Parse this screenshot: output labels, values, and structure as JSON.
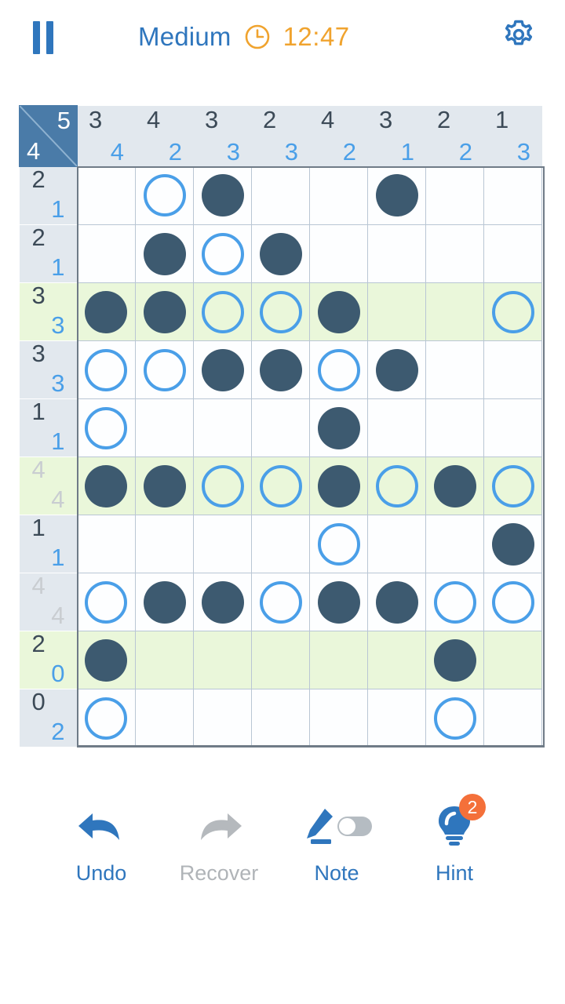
{
  "header": {
    "pause_icon": "pause-icon",
    "difficulty": "Medium",
    "clock_icon": "clock-icon",
    "timer": "12:47",
    "settings_icon": "gear-icon",
    "accent_blue": "#2f76bd",
    "timer_orange": "#f0a32e"
  },
  "board": {
    "corner": {
      "top_right": "5",
      "bottom_left": "4"
    },
    "col_headers": [
      {
        "dark": "3",
        "blue": "4",
        "done": false
      },
      {
        "dark": "4",
        "blue": "2",
        "done": false
      },
      {
        "dark": "3",
        "blue": "3",
        "done": false
      },
      {
        "dark": "2",
        "blue": "3",
        "done": false
      },
      {
        "dark": "4",
        "blue": "2",
        "done": false
      },
      {
        "dark": "3",
        "blue": "1",
        "done": false
      },
      {
        "dark": "2",
        "blue": "2",
        "done": false
      },
      {
        "dark": "1",
        "blue": "3",
        "done": false
      }
    ],
    "row_headers": [
      {
        "dark": "2",
        "blue": "1",
        "done": false,
        "highlight": false
      },
      {
        "dark": "2",
        "blue": "1",
        "done": false,
        "highlight": false
      },
      {
        "dark": "3",
        "blue": "3",
        "done": false,
        "highlight": true
      },
      {
        "dark": "3",
        "blue": "3",
        "done": false,
        "highlight": false
      },
      {
        "dark": "1",
        "blue": "1",
        "done": false,
        "highlight": false
      },
      {
        "dark": "4",
        "blue": "4",
        "done": true,
        "highlight": true
      },
      {
        "dark": "1",
        "blue": "1",
        "done": false,
        "highlight": false
      },
      {
        "dark": "4",
        "blue": "4",
        "done": true,
        "highlight": false
      },
      {
        "dark": "2",
        "blue": "0",
        "done": false,
        "highlight": true
      },
      {
        "dark": "0",
        "blue": "2",
        "done": false,
        "highlight": false
      }
    ],
    "legend": {
      "filled": "filled",
      "empty": "empty",
      "blank": ""
    },
    "cells": [
      [
        "",
        "empty",
        "filled",
        "",
        "",
        "filled",
        "",
        ""
      ],
      [
        "",
        "filled",
        "empty",
        "filled",
        "",
        "",
        "",
        ""
      ],
      [
        "filled",
        "filled",
        "empty",
        "empty",
        "filled",
        "",
        "",
        "empty"
      ],
      [
        "empty",
        "empty",
        "filled",
        "filled",
        "empty",
        "filled",
        "",
        ""
      ],
      [
        "empty",
        "",
        "",
        "",
        "filled",
        "",
        "",
        ""
      ],
      [
        "filled",
        "filled",
        "empty",
        "empty",
        "filled",
        "empty",
        "filled",
        "empty"
      ],
      [
        "",
        "",
        "",
        "",
        "empty",
        "",
        "",
        "filled"
      ],
      [
        "empty",
        "filled",
        "filled",
        "empty",
        "filled",
        "filled",
        "empty",
        "empty"
      ],
      [
        "filled",
        "",
        "",
        "",
        "",
        "",
        "filled",
        ""
      ],
      [
        "empty",
        "",
        "",
        "",
        "",
        "",
        "empty",
        ""
      ]
    ],
    "colors": {
      "filled_dot": "#3d5a70",
      "empty_ring": "#4a9fe8",
      "header_bg": "#e2e8ee",
      "highlight_bg": "#eaf7da",
      "corner_bg": "#4a7ba8",
      "grid_line": "#b9c6d4"
    }
  },
  "toolbar": {
    "undo": {
      "label": "Undo",
      "icon": "undo-arrow-icon",
      "enabled": true
    },
    "recover": {
      "label": "Recover",
      "icon": "redo-arrow-icon",
      "enabled": false
    },
    "note": {
      "label": "Note",
      "icon": "pencil-icon",
      "toggle_on": false
    },
    "hint": {
      "label": "Hint",
      "icon": "lightbulb-icon",
      "badge": "2",
      "badge_color": "#f4703a"
    }
  }
}
